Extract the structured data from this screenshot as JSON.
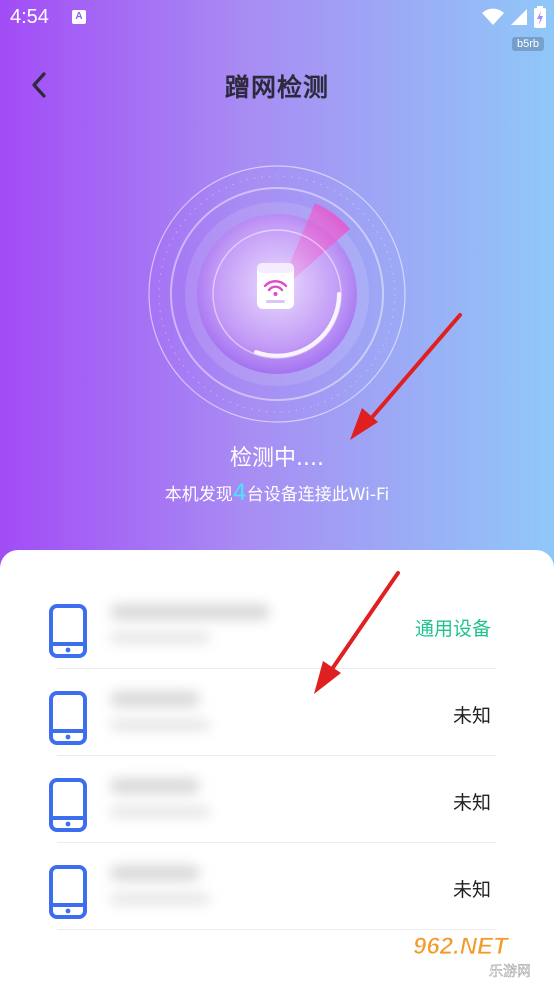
{
  "status": {
    "time": "4:54",
    "badge": "b5rb"
  },
  "header": {
    "title": "蹭网检测"
  },
  "scan": {
    "status_text": "检测中....",
    "found_prefix": "本机发现",
    "found_count": "4",
    "found_suffix": "台设备连接此Wi-Fi"
  },
  "devices": [
    {
      "type": "通用设备",
      "type_color": "#1fc38f"
    },
    {
      "type": "未知"
    },
    {
      "type": "未知"
    },
    {
      "type": "未知"
    }
  ],
  "watermark": {
    "text": "962.NET",
    "sub": "乐游网"
  },
  "colors": {
    "accent_green": "#1fc38f",
    "device_icon": "#3d6ef0",
    "count_highlight": "#49e3ff",
    "arrow": "#e02020"
  }
}
